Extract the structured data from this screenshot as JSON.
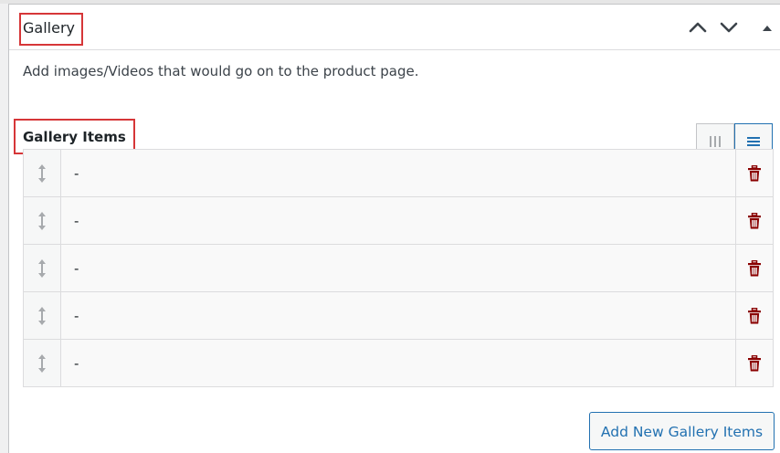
{
  "panel": {
    "title": "Gallery",
    "description": "Add images/Videos that would go on to the product page.",
    "header_icons": [
      "chevron-up-icon",
      "chevron-down-icon",
      "toggle-arrow-up-icon"
    ]
  },
  "gallery": {
    "title": "Gallery Items",
    "view_icons": [
      "columns-icon",
      "list-icon"
    ],
    "rows": [
      {
        "label": "-"
      },
      {
        "label": "-"
      },
      {
        "label": "-"
      },
      {
        "label": "-"
      },
      {
        "label": "-"
      }
    ],
    "add_button_label": "Add New Gallery Items"
  },
  "colors": {
    "accent": "#2271b1",
    "highlight": "#d63638",
    "delete": "#8a0000"
  }
}
